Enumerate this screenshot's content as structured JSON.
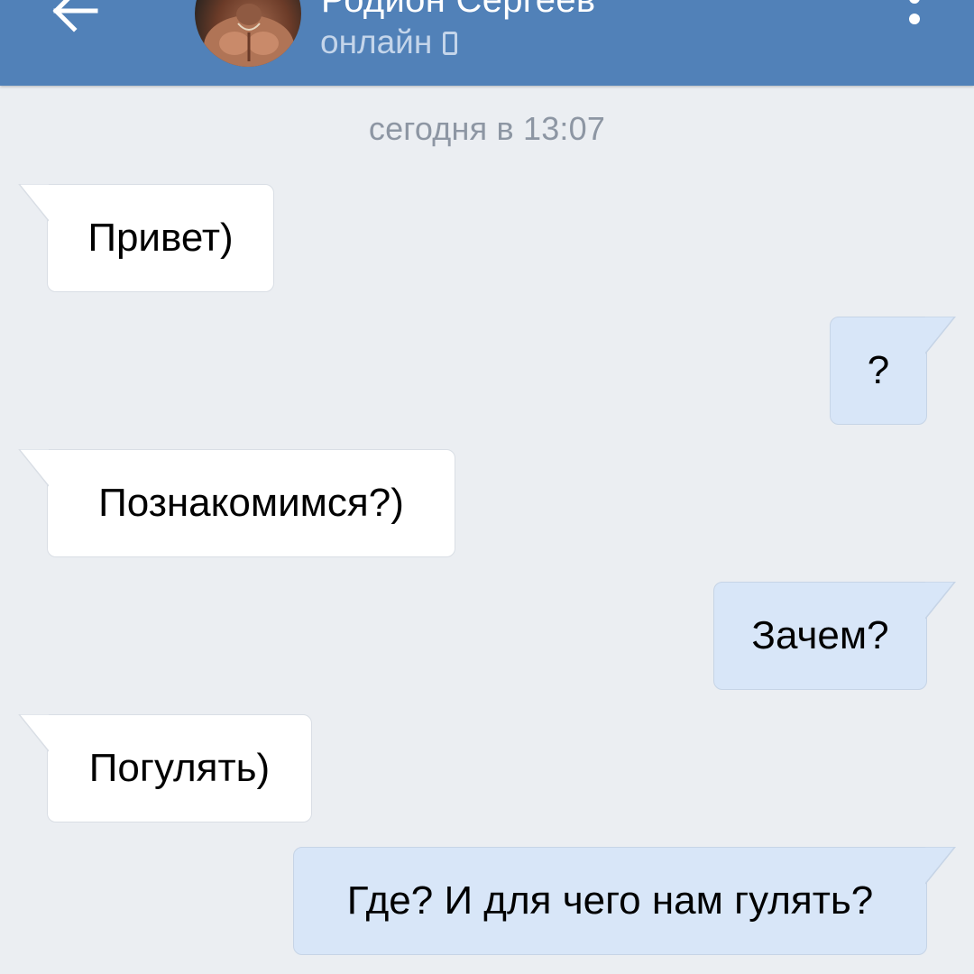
{
  "header": {
    "contact_name": "Родион Сергеев",
    "status": "онлайн",
    "back_icon": "arrow-left-icon",
    "status_icon": "mobile-phone-icon",
    "menu_icon": "more-vertical-icon",
    "background_color": "#5181b8"
  },
  "chat": {
    "date_separator": "сегодня в 13:07",
    "background_color": "#ebeef2",
    "incoming_bubble_color": "#ffffff",
    "outgoing_bubble_color": "#d8e6f8",
    "messages": [
      {
        "direction": "incoming",
        "text": "Привет)"
      },
      {
        "direction": "outgoing",
        "text": "?"
      },
      {
        "direction": "incoming",
        "text": "Познакомимся?)"
      },
      {
        "direction": "outgoing",
        "text": "Зачем?"
      },
      {
        "direction": "incoming",
        "text": "Погулять)"
      },
      {
        "direction": "outgoing",
        "text": "Где? И для чего нам гулять?"
      }
    ]
  }
}
